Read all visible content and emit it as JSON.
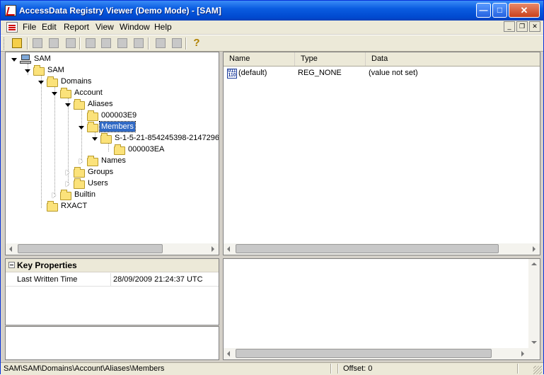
{
  "window": {
    "title": "AccessData Registry Viewer (Demo Mode) - [SAM]",
    "minimize_glyph": "—",
    "maximize_glyph": "□",
    "close_glyph": "✕"
  },
  "menu": {
    "items": [
      "File",
      "Edit",
      "Report",
      "View",
      "Window",
      "Help"
    ],
    "mdi_minimize": "_",
    "mdi_restore": "❐",
    "mdi_close": "✕"
  },
  "toolbar": {
    "icons": [
      "open-folder-icon",
      "computer-icon",
      "find-icon",
      "key-icon",
      "export-icon",
      "report-icon",
      "report-add-icon",
      "report-view-icon",
      "tool-a-icon",
      "tool-b-icon",
      "help-icon"
    ],
    "help_glyph": "?"
  },
  "tree": {
    "nodes": [
      {
        "label": "SAM",
        "icon": "computer-icon",
        "expander": "open"
      },
      {
        "label": "SAM",
        "icon": "folder-icon",
        "expander": "open"
      },
      {
        "label": "Domains",
        "icon": "folder-icon",
        "expander": "open"
      },
      {
        "label": "Account",
        "icon": "folder-icon",
        "expander": "open"
      },
      {
        "label": "Aliases",
        "icon": "folder-icon",
        "expander": "open"
      },
      {
        "label": "000003E9",
        "icon": "folder-icon",
        "expander": "none"
      },
      {
        "label": "Members",
        "icon": "folder-icon",
        "expander": "open",
        "selected": true
      },
      {
        "label": "S-1-5-21-854245398-2147296",
        "icon": "folder-icon",
        "expander": "open"
      },
      {
        "label": "000003EA",
        "icon": "folder-icon",
        "expander": "none"
      },
      {
        "label": "Names",
        "icon": "folder-icon",
        "expander": "closed"
      },
      {
        "label": "Groups",
        "icon": "folder-icon",
        "expander": "closed"
      },
      {
        "label": "Users",
        "icon": "folder-icon",
        "expander": "closed"
      },
      {
        "label": "Builtin",
        "icon": "folder-icon",
        "expander": "closed"
      },
      {
        "label": "RXACT",
        "icon": "folder-icon",
        "expander": "none"
      }
    ]
  },
  "list": {
    "columns": [
      "Name",
      "Type",
      "Data"
    ],
    "rows": [
      {
        "icon": "registry-binary-value-icon",
        "icon_text": "011 110",
        "name": "(default)",
        "type": "REG_NONE",
        "data": "(value not set)"
      }
    ]
  },
  "properties": {
    "title": "Key Properties",
    "rows": [
      {
        "name": "Last Written Time",
        "value": "28/09/2009 21:24:37 UTC"
      }
    ]
  },
  "statusbar": {
    "path": "SAM\\SAM\\Domains\\Account\\Aliases\\Members",
    "offset": "Offset: 0"
  },
  "colors": {
    "titlebar": "#0a5ce0",
    "selection": "#316ac5",
    "folder": "#fbe27a"
  }
}
